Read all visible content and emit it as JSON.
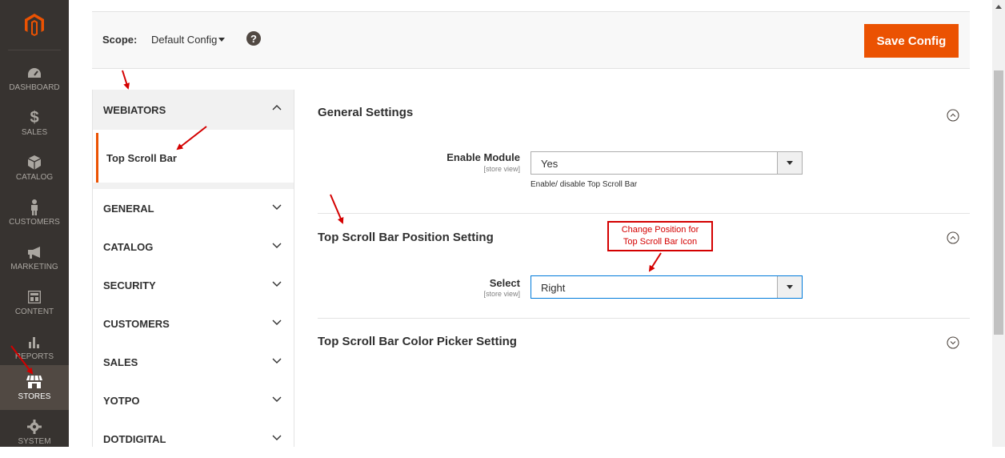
{
  "admin_nav": {
    "items": [
      {
        "label": "DASHBOARD",
        "icon": "dashboard-icon"
      },
      {
        "label": "SALES",
        "icon": "dollar-icon"
      },
      {
        "label": "CATALOG",
        "icon": "cube-icon"
      },
      {
        "label": "CUSTOMERS",
        "icon": "person-icon"
      },
      {
        "label": "MARKETING",
        "icon": "megaphone-icon"
      },
      {
        "label": "CONTENT",
        "icon": "content-icon"
      },
      {
        "label": "REPORTS",
        "icon": "bar-chart-icon"
      },
      {
        "label": "STORES",
        "icon": "store-icon",
        "active": true
      },
      {
        "label": "SYSTEM",
        "icon": "gear-icon"
      }
    ]
  },
  "scope": {
    "label": "Scope:",
    "value": "Default Config",
    "help": "?"
  },
  "toolbar": {
    "save_label": "Save Config"
  },
  "config_tabs": {
    "groups": [
      {
        "label": "WEBIATORS",
        "expanded": true,
        "items": [
          "Top Scroll Bar"
        ]
      },
      {
        "label": "GENERAL"
      },
      {
        "label": "CATALOG"
      },
      {
        "label": "SECURITY"
      },
      {
        "label": "CUSTOMERS"
      },
      {
        "label": "SALES"
      },
      {
        "label": "YOTPO"
      },
      {
        "label": "DOTDIGITAL"
      }
    ]
  },
  "sections": {
    "general": {
      "title": "General Settings",
      "expanded": true,
      "field": {
        "label": "Enable Module",
        "scope": "[store view]",
        "value": "Yes",
        "note": "Enable/ disable Top Scroll Bar"
      }
    },
    "position": {
      "title": "Top Scroll Bar Position Setting",
      "expanded": true,
      "field": {
        "label": "Select",
        "scope": "[store view]",
        "value": "Right"
      }
    },
    "color": {
      "title": "Top Scroll Bar Color Picker Setting",
      "expanded": false
    }
  },
  "annotation": {
    "line1": "Change Position for",
    "line2": "Top Scroll Bar Icon"
  },
  "colors": {
    "accent": "#eb5202",
    "sidebar": "#373330",
    "annotation": "#d40000",
    "focus": "#007bdb"
  }
}
